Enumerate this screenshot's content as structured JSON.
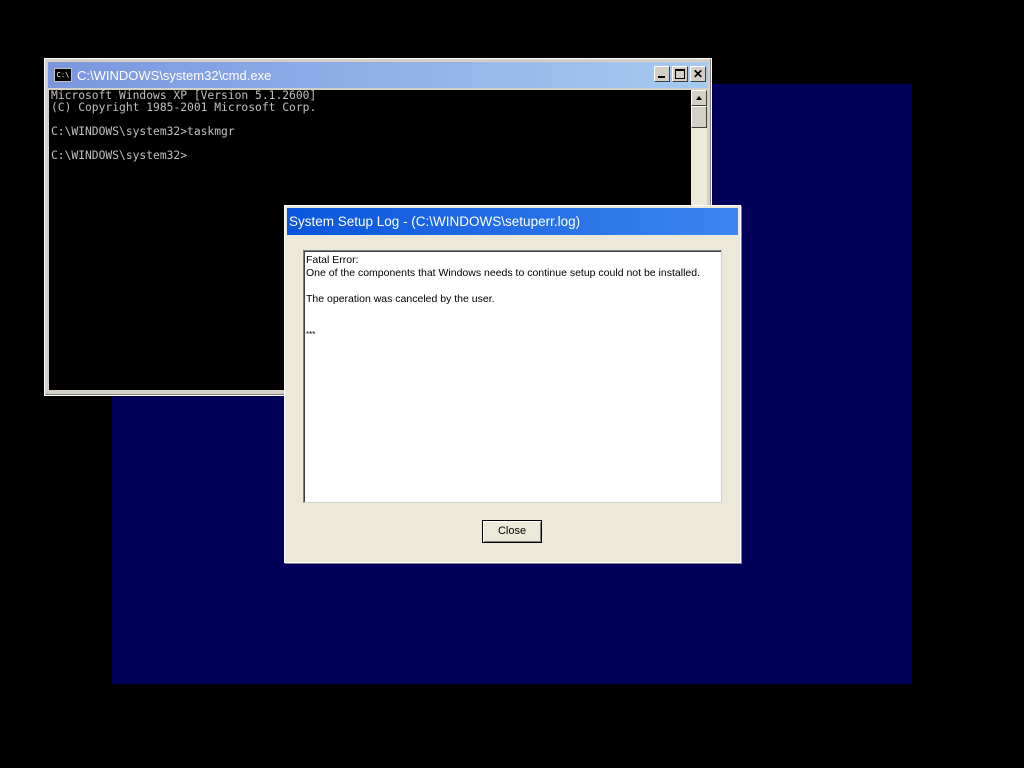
{
  "cmd_window": {
    "title": "C:\\WINDOWS\\system32\\cmd.exe",
    "icon_label": "C:\\",
    "lines": [
      "Microsoft Windows XP [Version 5.1.2600]",
      "(C) Copyright 1985-2001 Microsoft Corp.",
      "",
      "C:\\WINDOWS\\system32>taskmgr",
      "",
      "C:\\WINDOWS\\system32>"
    ]
  },
  "log_dialog": {
    "title": "System Setup Log - (C:\\WINDOWS\\setuperr.log)",
    "lines": {
      "fatal_label": "Fatal Error:",
      "fatal_message": "One of the components that Windows needs to continue setup could not be installed.",
      "canceled_message": "The operation was canceled by the user.",
      "marker": "***"
    },
    "close_label": "Close"
  },
  "colors": {
    "desktop": "#000000",
    "screen_panel": "#00005a",
    "cmd_titlebar_inactive": "#7a96df",
    "dialog_titlebar_active": "#0a55dc"
  }
}
